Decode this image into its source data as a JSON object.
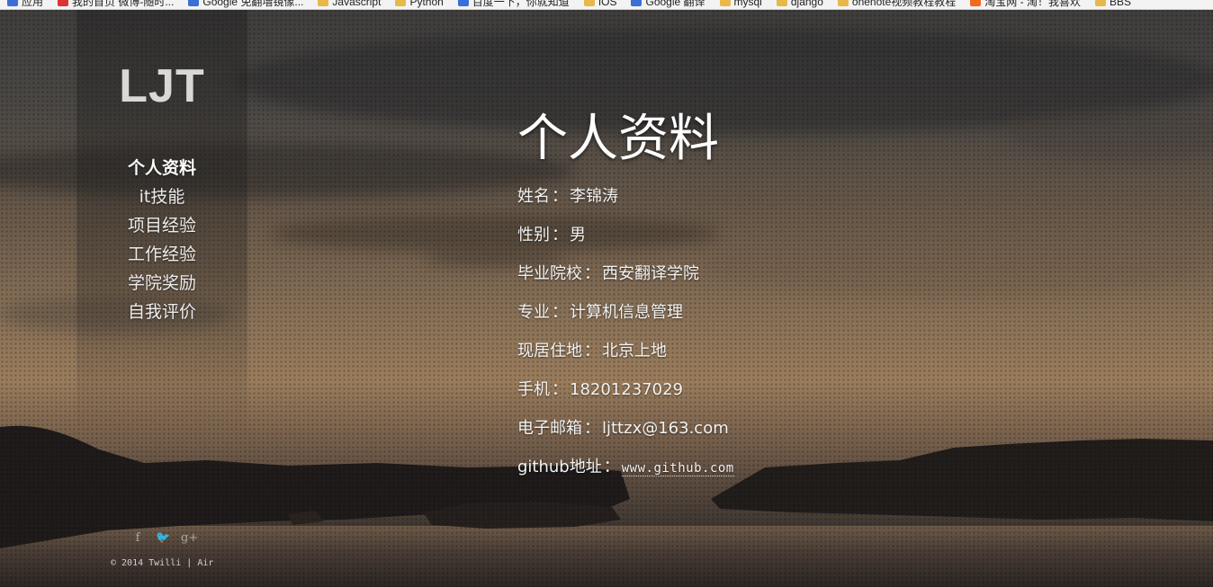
{
  "bookmarks": [
    {
      "label": "应用",
      "icon": "apps-icon"
    },
    {
      "label": "我的首页 微博-随时...",
      "icon": "weibo-icon"
    },
    {
      "label": "Google 免翻墙镜像...",
      "icon": "google-icon"
    },
    {
      "label": "Javascript",
      "icon": "folder-icon"
    },
    {
      "label": "Python",
      "icon": "folder-icon"
    },
    {
      "label": "百度一下，你就知道",
      "icon": "baidu-icon"
    },
    {
      "label": "IOS",
      "icon": "folder-icon"
    },
    {
      "label": "Google 翻译",
      "icon": "translate-icon"
    },
    {
      "label": "mysql",
      "icon": "folder-icon"
    },
    {
      "label": "django",
      "icon": "folder-icon"
    },
    {
      "label": "onenote视频教程教程",
      "icon": "folder-icon"
    },
    {
      "label": "淘宝网 - 淘！我喜欢",
      "icon": "taobao-icon"
    },
    {
      "label": "BBS",
      "icon": "folder-icon"
    }
  ],
  "sidebar": {
    "logo": "LJT",
    "nav": [
      {
        "label": "个人资料",
        "active": true
      },
      {
        "label": "it技能",
        "active": false
      },
      {
        "label": "项目经验",
        "active": false
      },
      {
        "label": "工作经验",
        "active": false
      },
      {
        "label": "学院奖励",
        "active": false
      },
      {
        "label": "自我评价",
        "active": false
      }
    ],
    "social": [
      {
        "glyph": "f",
        "icon": "facebook-icon"
      },
      {
        "glyph": "🐦",
        "icon": "twitter-icon"
      },
      {
        "glyph": "g+",
        "icon": "google-plus-icon"
      }
    ],
    "copyright": "© 2014 Twilli | Air"
  },
  "main": {
    "title": "个人资料",
    "fields": [
      {
        "label": "姓名",
        "value": "李锦涛"
      },
      {
        "label": "性别",
        "value": "男"
      },
      {
        "label": "毕业院校",
        "value": "西安翻译学院"
      },
      {
        "label": "专业",
        "value": "计算机信息管理"
      },
      {
        "label": "现居住地",
        "value": "北京上地"
      },
      {
        "label": "手机",
        "value": "18201237029"
      },
      {
        "label": "电子邮箱",
        "value": "ljttzx@163.com"
      }
    ],
    "github": {
      "label": "github地址",
      "value": "www.github.com"
    },
    "separator": "："
  }
}
